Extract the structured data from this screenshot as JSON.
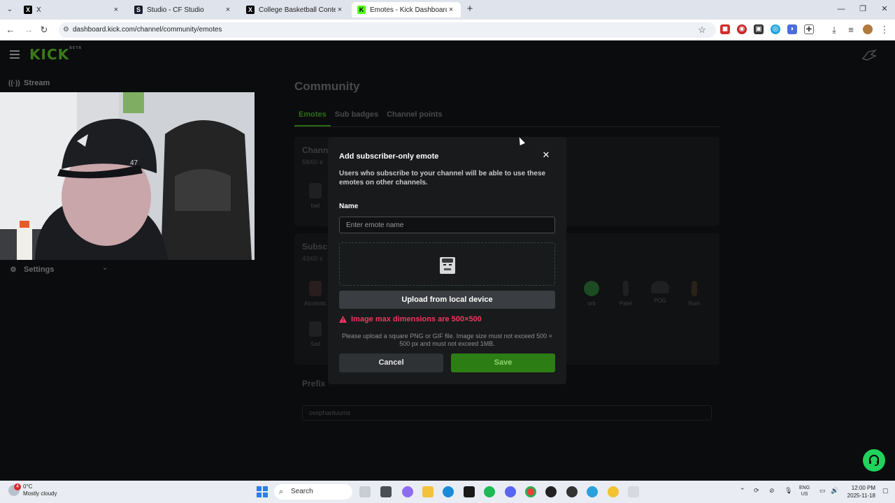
{
  "browser": {
    "tabs": [
      {
        "title": "X",
        "icon": "x-logo-icon",
        "active": false
      },
      {
        "title": "Studio - CF Studio",
        "icon": "studio-icon",
        "active": false
      },
      {
        "title": "College Basketball Content on",
        "icon": "x-logo-icon",
        "active": false
      },
      {
        "title": "Emotes - Kick Dashboard",
        "icon": "kick-icon",
        "active": true
      }
    ],
    "url": "dashboard.kick.com/channel/community/emotes"
  },
  "sidebar": {
    "logo": "KICK",
    "logo_badge": "BETA",
    "items": [
      {
        "label": "Stream",
        "icon": "broadcast-icon"
      },
      {
        "label": "Settings",
        "icon": "gear-icon"
      }
    ]
  },
  "main": {
    "title": "Community",
    "tabs": [
      "Emotes",
      "Sub badges",
      "Channel points"
    ],
    "active_tab": "Emotes",
    "channel_section": {
      "title": "Chann",
      "count": "58/60 e",
      "emotes": [
        "ball"
      ]
    },
    "subscriber_section": {
      "title": "Subsc",
      "count": "43/60 s",
      "emotes": [
        "Alcoholic",
        "orb",
        "Patel",
        "POG",
        "Rum",
        "Sad"
      ]
    },
    "prefix": {
      "title": "Prefix",
      "value": "ovophantuums"
    }
  },
  "modal": {
    "title": "Add subscriber-only emote",
    "description": "Users who subscribe to your channel will be able to use these emotes on other channels.",
    "name_label": "Name",
    "name_placeholder": "Enter emote name",
    "upload_label": "Upload from local device",
    "error": "Image max dimensions are 500×500",
    "help": "Please upload a square PNG or GIF file. Image size must not exceed 500 × 500 px and must not exceed 1MB.",
    "cancel_label": "Cancel",
    "save_label": "Save"
  },
  "taskbar": {
    "weather_temp": "0°C",
    "weather_desc": "Mostly cloudy",
    "weather_badge": "4",
    "search_label": "Search",
    "lang_line1": "ENG",
    "lang_line2": "US",
    "time": "12:00 PM",
    "date": "2025-11-18"
  },
  "colors": {
    "kick_green": "#53fc18",
    "save_green": "#2d7d15",
    "error_red": "#f2365e",
    "support_green": "#1fd35c"
  }
}
